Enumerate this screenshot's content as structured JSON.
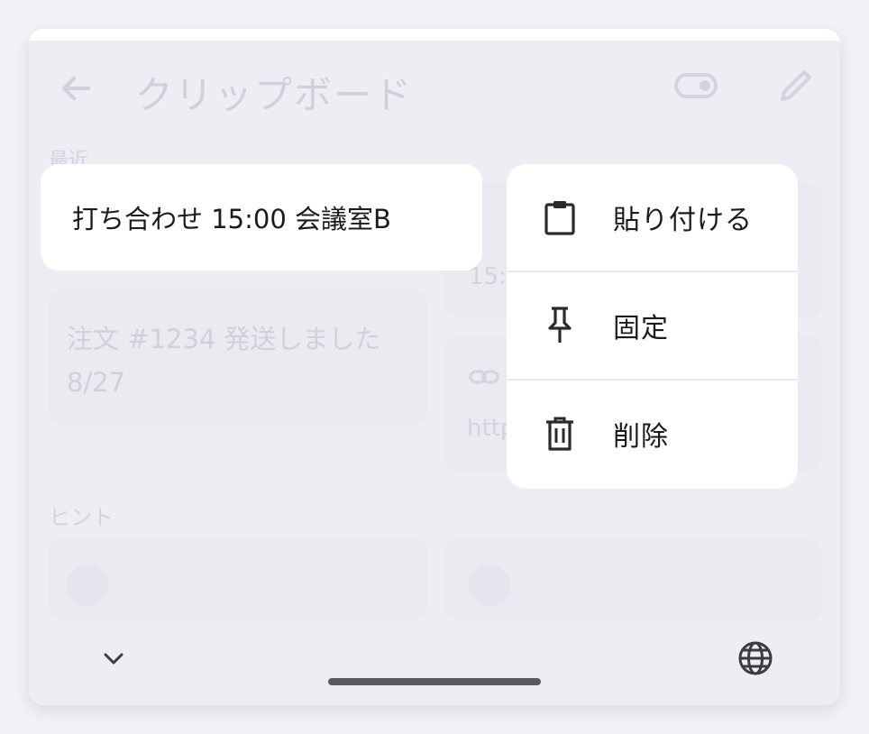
{
  "background": {
    "title": "クリップボード",
    "section_recent": "最近",
    "card_order_line1": "注文 #1234 発送しました",
    "card_order_line2": "8/27",
    "card_time_partial": "15:0",
    "card_link_partial": "http",
    "section_hint": "ヒント"
  },
  "preview": {
    "text": "打ち合わせ 15:00 会議室B"
  },
  "menu": {
    "items": [
      {
        "label": "貼り付ける",
        "icon": "clipboard-icon"
      },
      {
        "label": "固定",
        "icon": "pin-icon"
      },
      {
        "label": "削除",
        "icon": "trash-icon"
      }
    ]
  },
  "colors": {
    "page_bg": "#f1f2f6",
    "panel_bg": "#eeedf3",
    "card_bg": "#ffffff",
    "text": "#1b1b1f",
    "home_indicator": "#5a5a5e"
  }
}
